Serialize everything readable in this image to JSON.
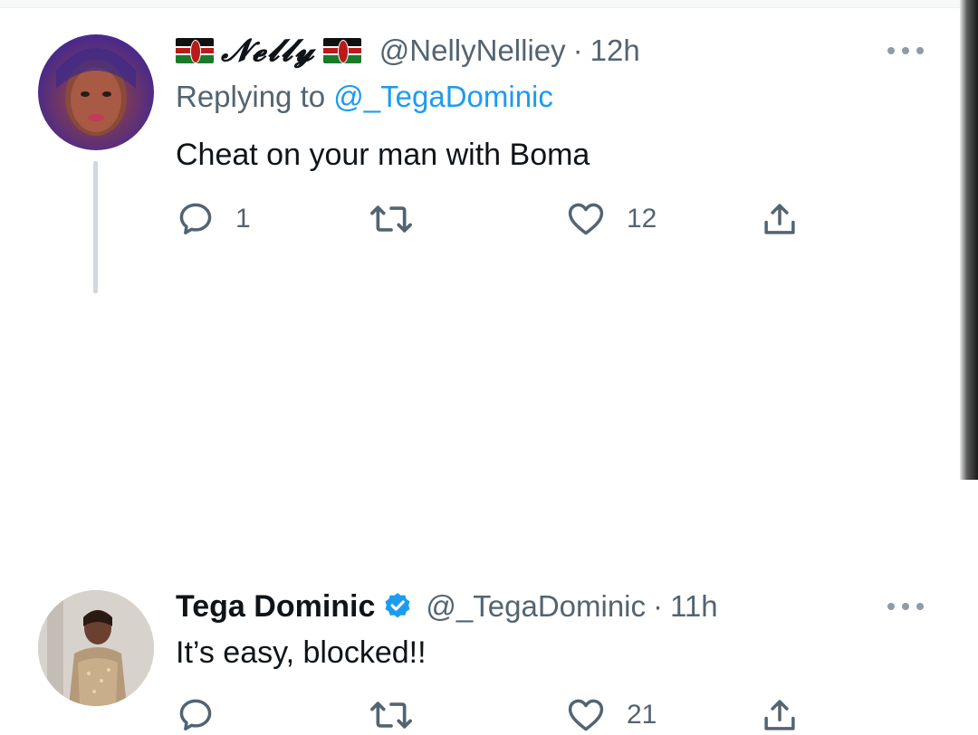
{
  "tweets": [
    {
      "display_name": "𝓝𝓮𝓵𝓵𝔂",
      "handle": "@NellyNelliey",
      "separator": "·",
      "time": "12h",
      "replying_prefix": "Replying to",
      "replying_to": "@_TegaDominic",
      "text": "Cheat on your man with Boma",
      "replies": "1",
      "retweets": "",
      "likes": "12",
      "avatar_icon": "user-avatar-nelly",
      "flag_icon": "kenya-flag-icon"
    },
    {
      "display_name": "Tega Dominic",
      "verified": true,
      "handle": "@_TegaDominic",
      "separator": "·",
      "time": "11h",
      "text": "It’s easy, blocked!!",
      "replies": "",
      "retweets": "",
      "likes": "21",
      "avatar_icon": "user-avatar-tega"
    }
  ],
  "colors": {
    "text": "#0f1419",
    "secondary": "#536471",
    "accent": "#1d9bf0",
    "thread_line": "#cfd9de"
  }
}
